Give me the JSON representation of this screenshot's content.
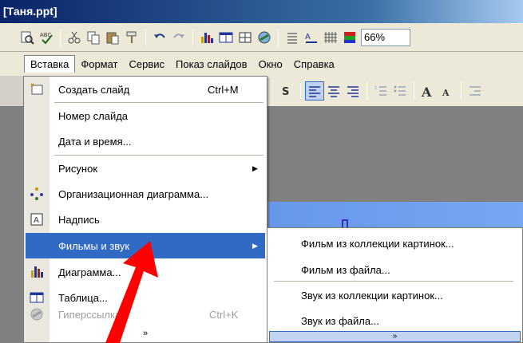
{
  "window": {
    "title": "[Таня.ppt]"
  },
  "toolbar": {
    "icons": [
      "print-preview-icon",
      "spelling-icon",
      "cut-icon",
      "copy-icon",
      "paste-icon",
      "format-painter-icon",
      "undo-icon",
      "redo-icon",
      "insert-chart-icon",
      "insert-table-icon",
      "tables-borders-icon",
      "insert-hyperlink-icon",
      "expand-collapse-icon",
      "show-formatting-icon",
      "show-grid-icon",
      "color-grayscale-icon"
    ],
    "zoom": "66%"
  },
  "menubar": {
    "items": [
      {
        "label": "Вставка",
        "active": true
      },
      {
        "label": "Формат"
      },
      {
        "label": "Сервис"
      },
      {
        "label": "Показ слайдов"
      },
      {
        "label": "Окно"
      },
      {
        "label": "Справка"
      }
    ]
  },
  "insert_menu": {
    "items": [
      {
        "label": "Создать слайд",
        "shortcut": "Ctrl+M",
        "icon": "new-slide-icon"
      },
      {
        "label": "Номер слайда"
      },
      {
        "label": "Дата и время..."
      },
      {
        "label": "Рисунок",
        "submenu": true
      },
      {
        "label": "Организационная диаграмма...",
        "icon": "org-chart-icon"
      },
      {
        "label": "Надпись",
        "icon": "text-box-icon"
      },
      {
        "label": "Фильмы и звук",
        "submenu": true,
        "highlighted": true
      },
      {
        "label": "Диаграмма...",
        "icon": "chart-icon"
      },
      {
        "label": "Таблица...",
        "icon": "table-icon"
      },
      {
        "label": "Гиперссылка...",
        "shortcut": "Ctrl+K",
        "icon": "hyperlink-icon",
        "disabled": true
      }
    ],
    "more": "»"
  },
  "movies_submenu": {
    "items": [
      {
        "label": "Фильм из коллекции картинок..."
      },
      {
        "label": "Фильм из файла..."
      },
      {
        "label": "Звук из коллекции картинок..."
      },
      {
        "label": "Звук из файла..."
      }
    ],
    "more": "»"
  },
  "colors": {
    "highlight": "#316ac5",
    "annotation_arrow": "#ff0000",
    "slide": "#6a9aea"
  }
}
